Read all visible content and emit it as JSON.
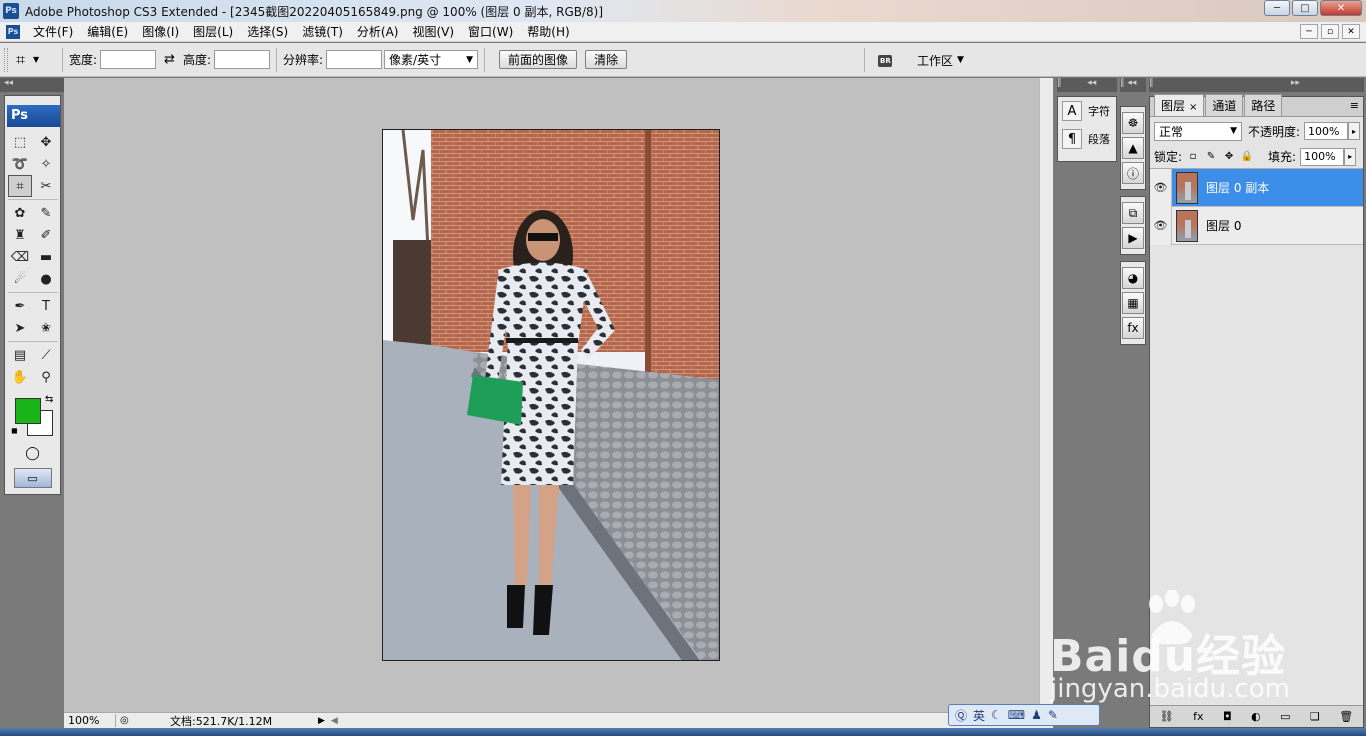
{
  "titlebar": {
    "app_icon": "Ps",
    "title": "Adobe Photoshop CS3 Extended - [2345截图20220405165849.png @ 100% (图层 0 副本, RGB/8)]",
    "buttons": {
      "minimize": "─",
      "maximize": "□",
      "close": "✕"
    }
  },
  "menubar": {
    "items": [
      "文件(F)",
      "编辑(E)",
      "图像(I)",
      "图层(L)",
      "选择(S)",
      "滤镜(T)",
      "分析(A)",
      "视图(V)",
      "窗口(W)",
      "帮助(H)"
    ],
    "doc_buttons": [
      "─",
      "▫",
      "✕"
    ]
  },
  "options": {
    "tool_glyph": "⌗",
    "width_label": "宽度:",
    "width_value": "",
    "swap_glyph": "⇄",
    "height_label": "高度:",
    "height_value": "",
    "resolution_label": "分辨率:",
    "resolution_value": "",
    "unit_select": "像素/英寸",
    "front_image_button": "前面的图像",
    "clear_button": "清除",
    "workspace_label": "工作区"
  },
  "tools": {
    "badge": "Ps",
    "items": [
      {
        "name": "marquee-tool-icon",
        "glyph": "⬚"
      },
      {
        "name": "move-tool-icon",
        "glyph": "✥"
      },
      {
        "name": "lasso-tool-icon",
        "glyph": "➰"
      },
      {
        "name": "magic-wand-tool-icon",
        "glyph": "✧"
      },
      {
        "name": "crop-tool-icon",
        "glyph": "⌗"
      },
      {
        "name": "slice-tool-icon",
        "glyph": "✂"
      },
      {
        "name": "healing-brush-tool-icon",
        "glyph": "✿"
      },
      {
        "name": "brush-tool-icon",
        "glyph": "✎"
      },
      {
        "name": "clone-stamp-tool-icon",
        "glyph": "♜"
      },
      {
        "name": "history-brush-tool-icon",
        "glyph": "✐"
      },
      {
        "name": "eraser-tool-icon",
        "glyph": "⌫"
      },
      {
        "name": "gradient-tool-icon",
        "glyph": "▬"
      },
      {
        "name": "blur-tool-icon",
        "glyph": "☄"
      },
      {
        "name": "dodge-tool-icon",
        "glyph": "●"
      },
      {
        "name": "pen-tool-icon",
        "glyph": "✒"
      },
      {
        "name": "type-tool-icon",
        "glyph": "T"
      },
      {
        "name": "path-selection-tool-icon",
        "glyph": "➤"
      },
      {
        "name": "shape-tool-icon",
        "glyph": "✬"
      },
      {
        "name": "notes-tool-icon",
        "glyph": "▤"
      },
      {
        "name": "eyedropper-tool-icon",
        "glyph": "⟋"
      },
      {
        "name": "hand-tool-icon",
        "glyph": "✋"
      },
      {
        "name": "zoom-tool-icon",
        "glyph": "⚲"
      }
    ],
    "foreground_color": "#19b31a",
    "background_color": "#ffffff",
    "quickmask_glyph": "◯",
    "screenmode_glyph": "▭"
  },
  "status": {
    "zoom": "100%",
    "doc_info": "文档:521.7K/1.12M",
    "arrow": "▶",
    "left_arrow": "◀"
  },
  "character_panel": {
    "character_label": "字符",
    "character_glyph": "A",
    "paragraph_label": "段落",
    "paragraph_glyph": "¶"
  },
  "icon_column": [
    [
      "☸",
      "▲",
      "ⓘ"
    ],
    [
      "⧉",
      "▶"
    ],
    [
      "◕",
      "▦",
      "fx"
    ]
  ],
  "layers_panel": {
    "tabs": [
      "图层",
      "通道",
      "路径"
    ],
    "tab_close": "×",
    "menu_glyph": "≡",
    "blend_mode": "正常",
    "opacity_label": "不透明度:",
    "opacity_value": "100%",
    "lock_label": "锁定:",
    "lock_icons": [
      "▫",
      "✎",
      "✥",
      "🔒"
    ],
    "fill_label": "填充:",
    "fill_value": "100%",
    "layers": [
      {
        "name": "图层 0 副本",
        "selected": true
      },
      {
        "name": "图层 0",
        "selected": false
      }
    ],
    "footer_icons": [
      "⛓",
      "fx",
      "◘",
      "◐",
      "▭",
      "❏",
      "🗑"
    ]
  },
  "ime_bar": {
    "label": "英",
    "icons": [
      "☾",
      "⌨",
      "♟",
      "✎"
    ]
  },
  "watermark": {
    "logo": "Baidu经验",
    "url": "jingyan.baidu.com"
  }
}
